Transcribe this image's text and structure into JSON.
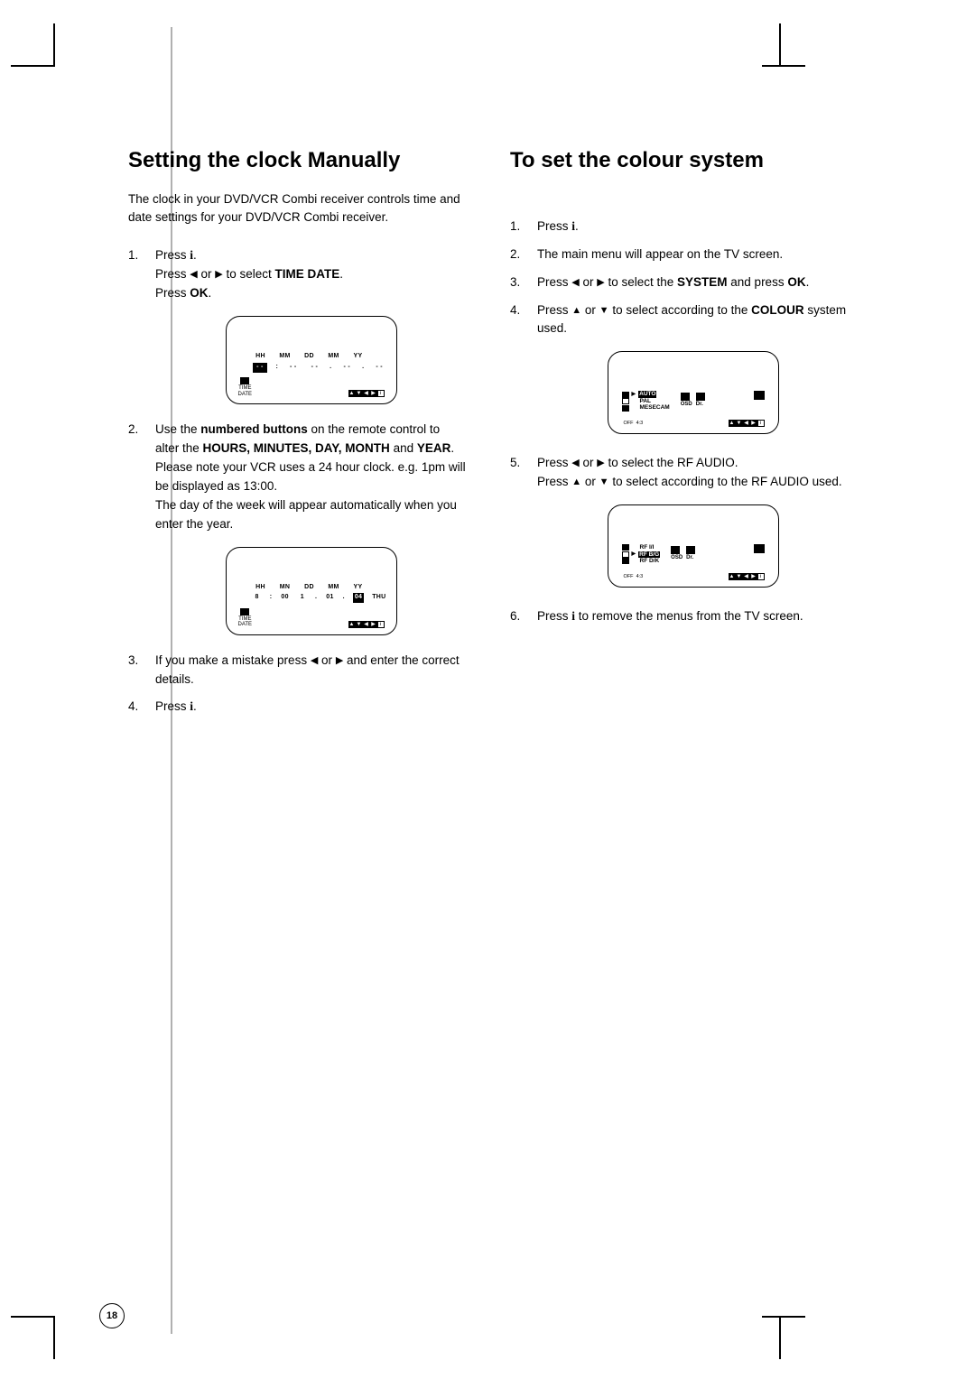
{
  "page_number": "18",
  "left": {
    "heading": "Setting the clock Manually",
    "intro": "The clock in your DVD/VCR Combi receiver controls time and date settings for your DVD/VCR Combi receiver.",
    "step1_a": "Press ",
    "step1_b": ".",
    "step1_line2_a": "Press ",
    "step1_line2_mid": " or ",
    "step1_line2_b": " to select ",
    "step1_line2_bold": "TIME DATE",
    "step1_line2_end": ".",
    "step1_line3_a": "Press ",
    "step1_line3_bold": "OK",
    "step1_line3_end": ".",
    "osd1": {
      "headers": [
        "HH",
        "MM",
        "DD",
        "MM",
        "YY"
      ],
      "row": [
        "- -",
        "- -",
        "- -",
        "- -",
        "- -"
      ],
      "hl_first": "- -",
      "sep1": ":",
      "sep2": ".",
      "sep3": ".",
      "icon_label1": "TIME",
      "icon_label2": "DATE"
    },
    "step2_a": "Use the ",
    "step2_bold1": "numbered buttons",
    "step2_b": " on the remote control to alter the ",
    "step2_bold2": "HOURS, MINUTES, DAY, MONTH",
    "step2_c": " and ",
    "step2_bold3": "YEAR",
    "step2_d": ".",
    "step2_note1": "Please note your VCR uses a 24 hour clock. e.g. 1pm will be displayed as 13:00.",
    "step2_note2": "The day of the week will appear automatically when you enter the year.",
    "osd2": {
      "headers": [
        "HH",
        "MN",
        "DD",
        "MM",
        "YY"
      ],
      "row_hh": "8",
      "row_mn": "00",
      "row_dd": "1",
      "row_mm": "01",
      "row_yy": "04",
      "row_day": "THU",
      "sep1": ":",
      "sep2": ".",
      "sep3": ".",
      "icon_label1": "TIME",
      "icon_label2": "DATE"
    },
    "step3_a": "If you make a mistake  press ",
    "step3_mid": " or ",
    "step3_b": " and enter the correct details.",
    "step4_a": "Press ",
    "step4_b": "."
  },
  "right": {
    "heading": "To set the colour system",
    "step1_a": "Press ",
    "step1_b": ".",
    "step2": "The main menu will appear on the TV screen.",
    "step3_a": "Press ",
    "step3_mid": " or ",
    "step3_b": " to select the ",
    "step3_bold": "SYSTEM",
    "step3_c": " and press ",
    "step3_bold2": "OK",
    "step3_d": ".",
    "step4_a": "Press ",
    "step4_mid": " or ",
    "step4_b": " to select according to the ",
    "step4_bold": "COLOUR",
    "step4_c": " system used.",
    "osd1": {
      "items": [
        "AUTO",
        "PAL",
        "MESECAM"
      ],
      "foot_left": "OFF",
      "foot_mid": "4:3",
      "nav_label": "OK",
      "right_lbl1": "OSD",
      "right_lbl2": "Dr."
    },
    "step5_a": "Press ",
    "step5_mid": " or ",
    "step5_b": " to select the RF AUDIO.",
    "step5_line2_a": "Press ",
    "step5_line2_mid": " or ",
    "step5_line2_b": " to select according to the RF AUDIO used.",
    "osd2": {
      "items": [
        "RF I/I",
        "RF B/G",
        "RF D/K"
      ],
      "foot_left": "OFF",
      "foot_mid": "4:3",
      "nav_label": "OK",
      "right_lbl1": "OSD",
      "right_lbl2": "Dr."
    },
    "step6_a": "Press ",
    "step6_b": " to remove the menus from the TV screen."
  },
  "glyphs": {
    "i": "i",
    "left": "◀",
    "right": "▶",
    "up": "▲",
    "down": "▼"
  }
}
